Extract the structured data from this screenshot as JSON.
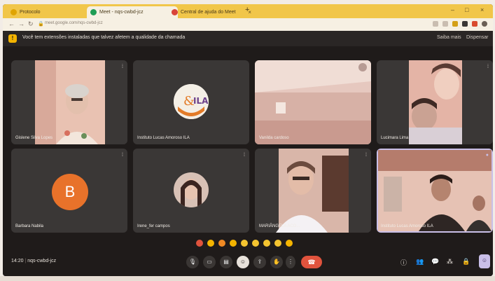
{
  "tabs": [
    {
      "label": "Protocolo",
      "close": "×"
    },
    {
      "label": "Meet - nqs-cwbd-jcz",
      "close": "×"
    },
    {
      "label": "Central de ajuda do Meet",
      "close": "×"
    }
  ],
  "new_tab": "+",
  "window_controls": {
    "minimize": "–",
    "maximize": "□",
    "close": "×"
  },
  "address": {
    "url": "meet.google.com/nqs-cwbd-jcz"
  },
  "notice": {
    "icon": "!",
    "text": "Você tem extensões instaladas que talvez afetem a qualidade da chamada",
    "learn_more": "Saiba mais",
    "dismiss": "Dispensar"
  },
  "participants": [
    {
      "name": "Gislene Silva Lopes"
    },
    {
      "name": "Instituto Lucas Amoroso ILA"
    },
    {
      "name": "Vanilda cardoso"
    },
    {
      "name": "Lucimara Lima"
    },
    {
      "name": "Barbara Nabila",
      "initial": "B"
    },
    {
      "name": "Irene_fer campos"
    },
    {
      "name": "MARIÂNGELA ACO..."
    },
    {
      "name": "Instituto Lucas Amoroso ILA"
    }
  ],
  "meeting": {
    "time": "14:20",
    "code": "nqs-cwbd-jcz"
  },
  "colors": {
    "accent": "#f1c64a",
    "end_call": "#e0533d",
    "avatar_b": "#e8722a",
    "tile": "#3a3736",
    "background": "#1f1b1a"
  }
}
